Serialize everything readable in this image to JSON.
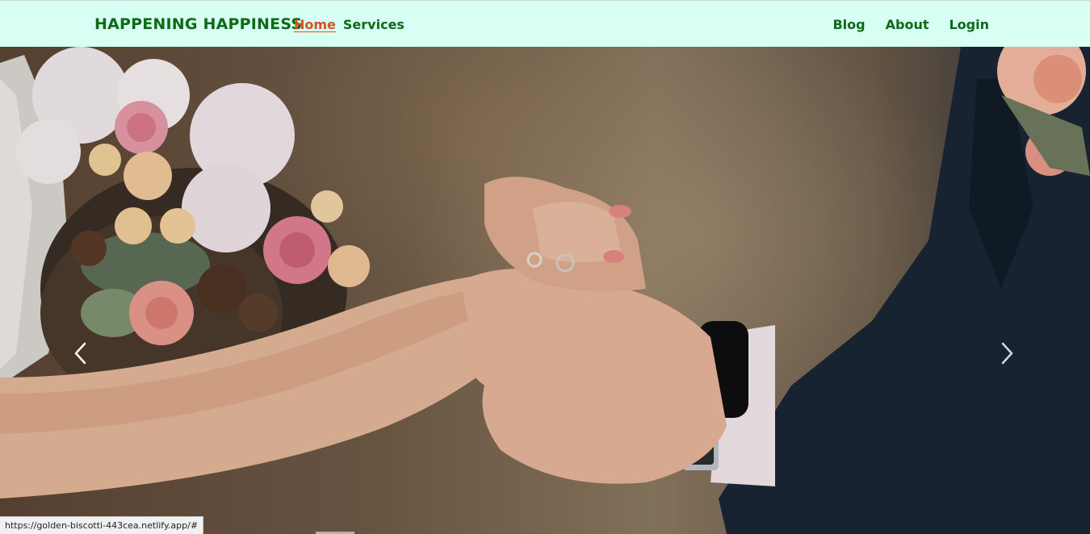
{
  "navbar": {
    "brand": "HAPPENING HAPPINESS",
    "left_links": [
      {
        "label": "Home",
        "active": true
      },
      {
        "label": "Services",
        "active": false
      }
    ],
    "right_links": [
      {
        "label": "Blog"
      },
      {
        "label": "About"
      },
      {
        "label": "Login"
      }
    ]
  },
  "carousel": {
    "slide_description_icon": "wedding-ring-photo",
    "prev_icon": "chevron-left-icon",
    "next_icon": "chevron-right-icon"
  },
  "status_bar": {
    "url": "https://golden-biscotti-443cea.netlify.app/#"
  },
  "colors": {
    "navbar_bg": "#d7fff4",
    "brand_green": "#0d6b14",
    "active_link": "#d2531e"
  }
}
